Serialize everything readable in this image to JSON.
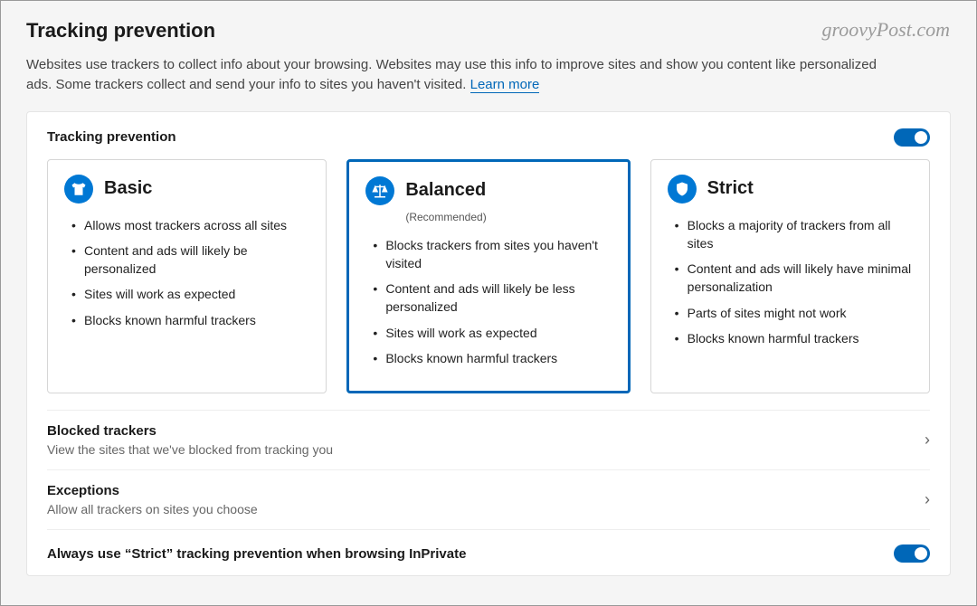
{
  "watermark": "groovyPost.com",
  "header": {
    "title": "Tracking prevention",
    "description_pre": "Websites use trackers to collect info about your browsing. Websites may use this info to improve sites and show you content like personalized ads. Some trackers collect and send your info to sites you haven't visited. ",
    "learn_more": "Learn more"
  },
  "panel": {
    "title": "Tracking prevention",
    "toggle_on": true
  },
  "cards": {
    "basic": {
      "title": "Basic",
      "subtitle": "",
      "bullets": [
        "Allows most trackers across all sites",
        "Content and ads will likely be personalized",
        "Sites will work as expected",
        "Blocks known harmful trackers"
      ]
    },
    "balanced": {
      "title": "Balanced",
      "subtitle": "(Recommended)",
      "bullets": [
        "Blocks trackers from sites you haven't visited",
        "Content and ads will likely be less personalized",
        "Sites will work as expected",
        "Blocks known harmful trackers"
      ]
    },
    "strict": {
      "title": "Strict",
      "subtitle": "",
      "bullets": [
        "Blocks a majority of trackers from all sites",
        "Content and ads will likely have minimal personalization",
        "Parts of sites might not work",
        "Blocks known harmful trackers"
      ]
    }
  },
  "rows": {
    "blocked": {
      "title": "Blocked trackers",
      "desc": "View the sites that we've blocked from tracking you"
    },
    "exceptions": {
      "title": "Exceptions",
      "desc": "Allow all trackers on sites you choose"
    },
    "inprivate": {
      "title": "Always use “Strict” tracking prevention when browsing InPrivate"
    }
  }
}
